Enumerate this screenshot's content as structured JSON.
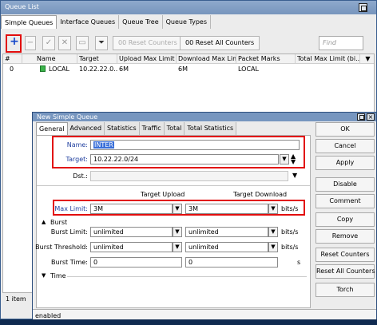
{
  "queue_list": {
    "title": "Queue List",
    "tabs": [
      "Simple Queues",
      "Interface Queues",
      "Queue Tree",
      "Queue Types"
    ],
    "toolbar": {
      "add_icon": "plus-icon",
      "reset_counters": "00 Reset Counters",
      "reset_all_counters": "00 Reset All Counters",
      "find_placeholder": "Find"
    },
    "columns": [
      "#",
      "Name",
      "Target",
      "Upload Max Limit",
      "Download Max Limit",
      "Packet Marks",
      "Total Max Limit (bi..."
    ],
    "rows": [
      {
        "num": "0",
        "name": "LOCAL",
        "target": "10.22.22.0...",
        "upload": "6M",
        "download": "6M",
        "marks": "LOCAL",
        "total": ""
      }
    ],
    "status": "1 item"
  },
  "new_simple_queue": {
    "title": "New Simple Queue",
    "tabs": [
      "General",
      "Advanced",
      "Statistics",
      "Traffic",
      "Total",
      "Total Statistics"
    ],
    "name_label": "Name:",
    "name_value": "INTER",
    "target_label": "Target:",
    "target_value": "10.22.22.0/24",
    "dst_label": "Dst.:",
    "dst_value": "",
    "target_upload_header": "Target Upload",
    "target_download_header": "Target Download",
    "max_limit_label": "Max Limit:",
    "max_limit_upload": "3M",
    "max_limit_download": "3M",
    "bits_unit": "bits/s",
    "burst_section": "Burst",
    "burst_limit_label": "Burst Limit:",
    "burst_limit_upload": "unlimited",
    "burst_limit_download": "unlimited",
    "burst_threshold_label": "Burst Threshold:",
    "burst_threshold_upload": "unlimited",
    "burst_threshold_download": "unlimited",
    "burst_time_label": "Burst Time:",
    "burst_time_upload": "0",
    "burst_time_download": "0",
    "seconds_unit": "s",
    "time_section": "Time",
    "status": "enabled",
    "buttons": [
      "OK",
      "Cancel",
      "Apply",
      "Disable",
      "Comment",
      "Copy",
      "Remove",
      "Reset Counters",
      "Reset All Counters",
      "Torch"
    ]
  },
  "colors": {
    "title_bar": "#7796bf",
    "highlight_box": "#e20d0d",
    "label_blue": "#1f3f9f",
    "selection": "#3a6fd8"
  }
}
